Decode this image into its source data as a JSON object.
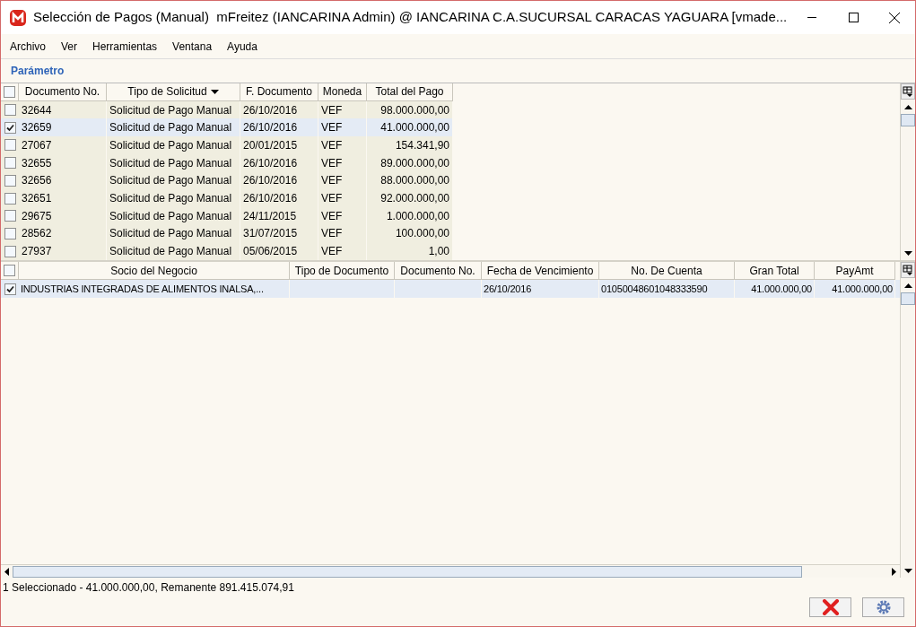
{
  "window": {
    "title": "Selección de Pagos (Manual)  mFreitez (IANCARINA Admin) @ IANCARINA C.A.SUCURSAL CARACAS YAGUARA [vmade..."
  },
  "menu": [
    "Archivo",
    "Ver",
    "Herramientas",
    "Ventana",
    "Ayuda"
  ],
  "section_title": "Parámetro",
  "payments_table": {
    "all_checked": false,
    "columns": [
      {
        "label": "Documento No.",
        "sorted": false
      },
      {
        "label": "Tipo de Solicitud",
        "sorted": true
      },
      {
        "label": "F. Documento",
        "sorted": false
      },
      {
        "label": "Moneda",
        "sorted": false
      },
      {
        "label": "Total del Pago",
        "sorted": false
      }
    ],
    "rows": [
      {
        "checked": false,
        "selected": false,
        "cells": [
          "32644",
          "Solicitud de Pago Manual",
          "26/10/2016",
          "VEF",
          "98.000.000,00"
        ]
      },
      {
        "checked": true,
        "selected": true,
        "cells": [
          "32659",
          "Solicitud de Pago Manual",
          "26/10/2016",
          "VEF",
          "41.000.000,00"
        ]
      },
      {
        "checked": false,
        "selected": false,
        "cells": [
          "27067",
          "Solicitud de Pago Manual",
          "20/01/2015",
          "VEF",
          "154.341,90"
        ]
      },
      {
        "checked": false,
        "selected": false,
        "cells": [
          "32655",
          "Solicitud de Pago Manual",
          "26/10/2016",
          "VEF",
          "89.000.000,00"
        ]
      },
      {
        "checked": false,
        "selected": false,
        "cells": [
          "32656",
          "Solicitud de Pago Manual",
          "26/10/2016",
          "VEF",
          "88.000.000,00"
        ]
      },
      {
        "checked": false,
        "selected": false,
        "cells": [
          "32651",
          "Solicitud de Pago Manual",
          "26/10/2016",
          "VEF",
          "92.000.000,00"
        ]
      },
      {
        "checked": false,
        "selected": false,
        "cells": [
          "29675",
          "Solicitud de Pago Manual",
          "24/11/2015",
          "VEF",
          "1.000.000,00"
        ]
      },
      {
        "checked": false,
        "selected": false,
        "cells": [
          "28562",
          "Solicitud de Pago Manual",
          "31/07/2015",
          "VEF",
          "100.000,00"
        ]
      },
      {
        "checked": false,
        "selected": false,
        "cells": [
          "27937",
          "Solicitud de Pago Manual",
          "05/06/2015",
          "VEF",
          "1,00"
        ]
      }
    ]
  },
  "details_table": {
    "all_checked": false,
    "columns": [
      "Socio del Negocio",
      "Tipo de Documento",
      "Documento No.",
      "Fecha de Vencimiento",
      "No. De Cuenta",
      "Gran Total",
      "PayAmt"
    ],
    "rows": [
      {
        "checked": true,
        "selected": true,
        "cells": [
          "INDUSTRIAS INTEGRADAS DE ALIMENTOS INALSA,...",
          "",
          "",
          "26/10/2016",
          "01050048601048333590",
          "41.000.000,00",
          "41.000.000,00"
        ]
      }
    ]
  },
  "status_bar": "1 Seleccionado - 41.000.000,00, Remanente 891.415.074,91"
}
